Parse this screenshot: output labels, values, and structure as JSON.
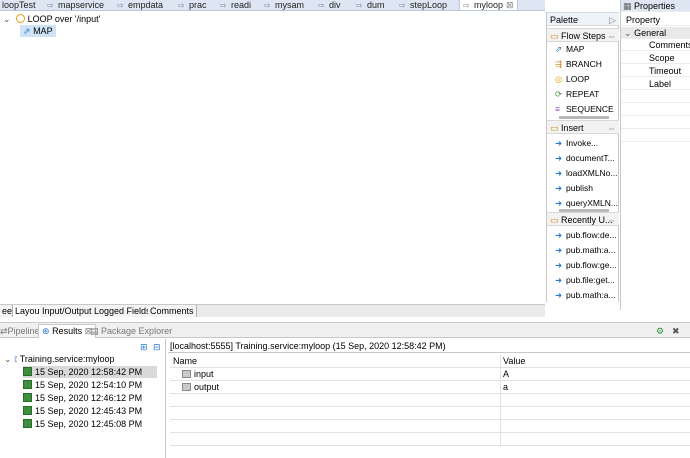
{
  "editor_tabs": [
    {
      "label": "loopTest"
    },
    {
      "label": "mapservice"
    },
    {
      "label": "empdata"
    },
    {
      "label": "prac"
    },
    {
      "label": "readi"
    },
    {
      "label": "mysam"
    },
    {
      "label": "div"
    },
    {
      "label": "dum"
    },
    {
      "label": "stepLoop"
    },
    {
      "label": "myloop",
      "active": true,
      "close": "⊠"
    }
  ],
  "flow_tree": {
    "loop_label": "LOOP over '/input'",
    "map_label": "MAP"
  },
  "palette": {
    "title": "Palette",
    "sections": [
      {
        "title": "Flow Steps",
        "items": [
          "MAP",
          "BRANCH",
          "LOOP",
          "REPEAT",
          "SEQUENCE"
        ]
      },
      {
        "title": "Insert",
        "items": [
          "Invoke...",
          "documentT...",
          "loadXMLNo...",
          "publish",
          "queryXMLN..."
        ]
      },
      {
        "title": "Recently U...",
        "items": [
          "pub.flow:de...",
          "pub.math:a...",
          "pub.flow:ge...",
          "pub.file:get...",
          "pub.math:a..."
        ]
      }
    ]
  },
  "properties": {
    "title": "Properties",
    "header": "Property",
    "group": "General",
    "rows": [
      "Comments",
      "Scope",
      "Timeout",
      "Label"
    ]
  },
  "editor_bottom_tabs": [
    "ee",
    "Layout",
    "Input/Output",
    "Logged Fields",
    "Comments"
  ],
  "view_tabs": [
    {
      "label": "Pipeline",
      "active": false
    },
    {
      "label": "Results",
      "active": true
    },
    {
      "label": "Package Explorer",
      "active": false
    }
  ],
  "results": {
    "root": "Training.service:myloop",
    "runs": [
      "15 Sep, 2020 12:58:42 PM",
      "15 Sep, 2020 12:54:10 PM",
      "15 Sep, 2020 12:46:12 PM",
      "15 Sep, 2020 12:45:43 PM",
      "15 Sep, 2020 12:45:08 PM"
    ],
    "detail_title": "[localhost:5555] Training.service:myloop (15 Sep, 2020 12:58:42 PM)",
    "columns": {
      "name": "Name",
      "value": "Value"
    },
    "rows": [
      {
        "name": "input",
        "value": "A"
      },
      {
        "name": "output",
        "value": "a"
      }
    ]
  },
  "colors": {
    "accent": "#2d7bd0",
    "loop_icon": "#e39b12",
    "selection": "#cfe3f8"
  }
}
